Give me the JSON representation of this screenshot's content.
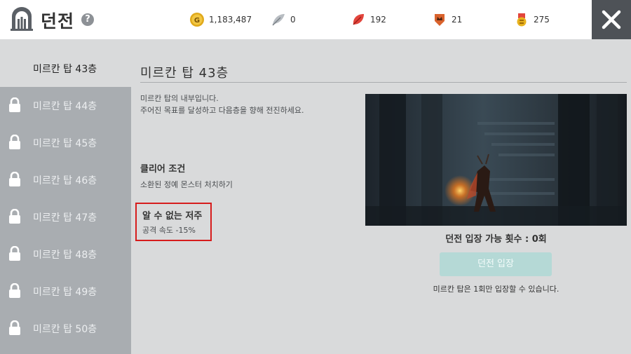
{
  "header": {
    "title": "던전",
    "help_symbol": "?",
    "close_icon": "close-icon"
  },
  "currencies": [
    {
      "icon": "gold-coin-icon",
      "label": "G",
      "value": "1,183,487",
      "color": "#e0a91b"
    },
    {
      "icon": "feather-icon",
      "value": "0",
      "color": "#9aa0a6"
    },
    {
      "icon": "red-leaf-icon",
      "value": "192",
      "color": "#e2453c"
    },
    {
      "icon": "crown-badge-icon",
      "value": "21",
      "color": "#d9622c"
    },
    {
      "icon": "medal-icon",
      "value": "275",
      "color": "#e8b21d"
    }
  ],
  "sidebar": {
    "items": [
      {
        "label": "미르칸 탑 43층",
        "locked": false,
        "active": true
      },
      {
        "label": "미르칸 탑 44층",
        "locked": true
      },
      {
        "label": "미르칸 탑 45층",
        "locked": true
      },
      {
        "label": "미르칸 탑 46층",
        "locked": true
      },
      {
        "label": "미르칸 탑 47층",
        "locked": true
      },
      {
        "label": "미르칸 탑 48층",
        "locked": true
      },
      {
        "label": "미르칸 탑 49층",
        "locked": true
      },
      {
        "label": "미르칸 탑 50층",
        "locked": true
      }
    ]
  },
  "main": {
    "title": "미르칸 탑 43층",
    "description_line1": "미르칸 탑의 내부입니다.",
    "description_line2": "주어진 목표를 달성하고 다음층을 향해 전진하세요.",
    "clear_condition_heading": "클리어 조건",
    "clear_condition_text": "소환된 정예 몬스터 처치하기",
    "curse_heading": "알 수 없는 저주",
    "curse_text": "공격 속도  -15%",
    "entry_count": "던전 입장 가능 횟수 : 0회",
    "enter_button": "던전 입장",
    "entry_note": "미르칸 탑은 1회만 입장할 수 있습니다."
  },
  "colors": {
    "highlight_border": "#d61c1c",
    "enter_button_bg": "#b5d9d6",
    "sidebar_locked_bg": "#a9adb1",
    "close_button_bg": "#4e5257"
  }
}
